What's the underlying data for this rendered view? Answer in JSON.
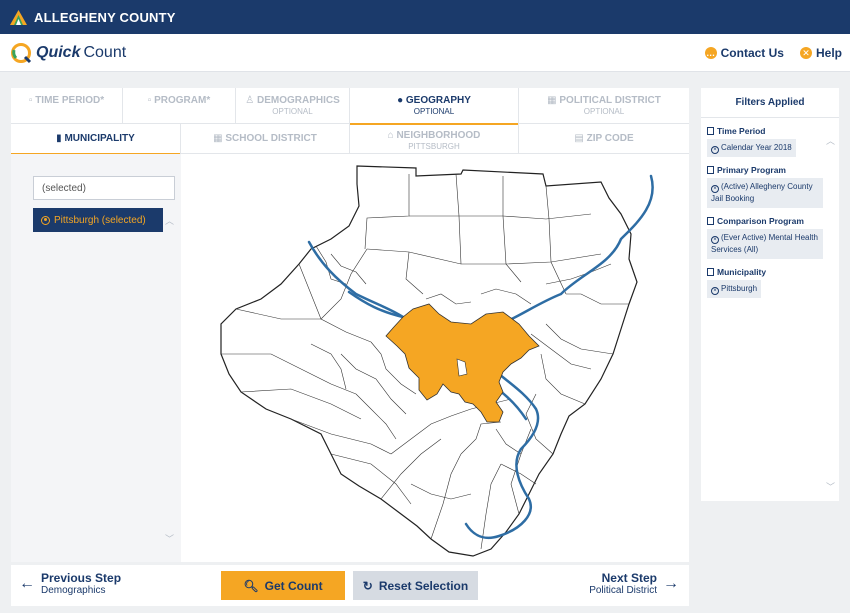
{
  "app": {
    "org_title": "ALLEGHENY COUNTY",
    "logo_quick": "Quick",
    "logo_count": "Count",
    "contact_label": "Contact Us",
    "help_label": "Help"
  },
  "steps": [
    {
      "label": "TIME PERIOD*",
      "sub": "",
      "icon": "calendar-icon",
      "active": false
    },
    {
      "label": "PROGRAM*",
      "sub": "",
      "icon": "document-icon",
      "active": false
    },
    {
      "label": "DEMOGRAPHICS",
      "sub": "OPTIONAL",
      "icon": "person-icon",
      "active": false
    },
    {
      "label": "GEOGRAPHY",
      "sub": "OPTIONAL",
      "icon": "map-pin-icon",
      "active": true
    },
    {
      "label": "POLITICAL DISTRICT",
      "sub": "OPTIONAL",
      "icon": "building-icon",
      "active": false
    }
  ],
  "geo_tabs": [
    {
      "label": "MUNICIPALITY",
      "sub": "",
      "icon": "building-icon",
      "active": true
    },
    {
      "label": "SCHOOL DISTRICT",
      "sub": "",
      "icon": "school-icon",
      "active": false
    },
    {
      "label": "NEIGHBORHOOD",
      "sub": "PITTSBURGH",
      "icon": "home-icon",
      "active": false
    },
    {
      "label": "ZIP CODE",
      "sub": "",
      "icon": "grid-icon",
      "active": false
    }
  ],
  "search": {
    "value": "(selected)"
  },
  "selected_item": "Pittsburgh (selected)",
  "footer": {
    "prev_title": "Previous Step",
    "prev_sub": "Demographics",
    "get_count": "Get Count",
    "reset": "Reset Selection",
    "next_title": "Next Step",
    "next_sub": "Political District"
  },
  "filters": {
    "title": "Filters Applied",
    "groups": [
      {
        "label": "Time Period",
        "chip": "Calendar Year 2018"
      },
      {
        "label": "Primary Program",
        "chip": "(Active) Allegheny County Jail Booking"
      },
      {
        "label": "Comparison Program",
        "chip": "(Ever Active) Mental Health Services (All)"
      },
      {
        "label": "Municipality",
        "chip": "Pittsburgh"
      }
    ]
  },
  "colors": {
    "navy": "#1b3a6b",
    "accent": "#f5a623",
    "river": "#2e6da4"
  }
}
